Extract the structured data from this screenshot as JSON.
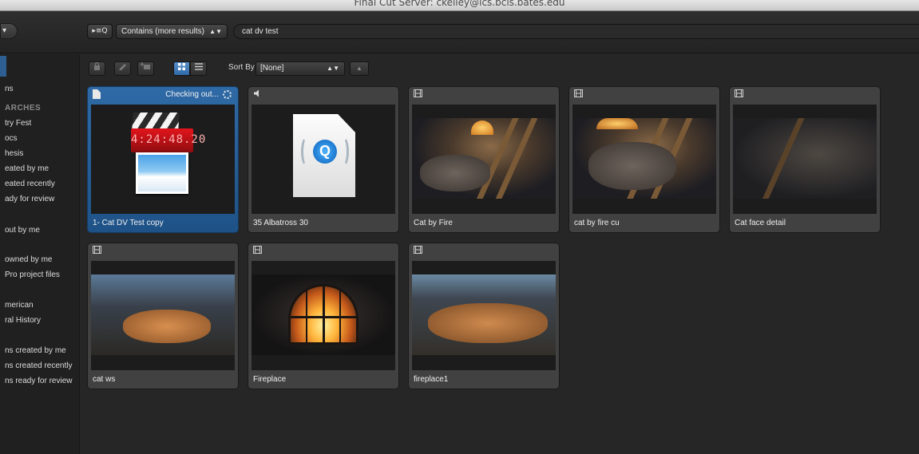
{
  "window": {
    "title": "Final Cut Server: ckelley@ics.bcis.bates.edu"
  },
  "search": {
    "user_menu_label": "▾",
    "mode_button_label": "▸≡Q",
    "mode_select_label": "Contains (more results)",
    "query": "cat dv test"
  },
  "sidebar": {
    "items": [
      {
        "label": "ns",
        "type": "item"
      },
      {
        "label": "ARCHES",
        "type": "heading"
      },
      {
        "label": "try Fest",
        "type": "item"
      },
      {
        "label": "ocs",
        "type": "item"
      },
      {
        "label": "hesis",
        "type": "item"
      },
      {
        "label": "eated by me",
        "type": "item"
      },
      {
        "label": "eated recently",
        "type": "item"
      },
      {
        "label": "ady for review",
        "type": "item"
      },
      {
        "label": "out by me",
        "type": "item"
      },
      {
        "label": "owned by me",
        "type": "item"
      },
      {
        "label": "Pro project files",
        "type": "item"
      },
      {
        "label": "merican",
        "type": "item"
      },
      {
        "label": "ral History",
        "type": "item"
      },
      {
        "label": "ns created by me",
        "type": "item"
      },
      {
        "label": "ns created recently",
        "type": "item"
      },
      {
        "label": "ns ready for review",
        "type": "item"
      }
    ]
  },
  "toolbar": {
    "sort_by_label": "Sort By",
    "sort_by_value": "[None]"
  },
  "assets": [
    {
      "name": "1- Cat DV Test copy",
      "type": "project",
      "status": "Checking out...",
      "selected": true
    },
    {
      "name": "35 Albatross 30",
      "type": "audio",
      "status": "",
      "selected": false
    },
    {
      "name": "Cat by Fire",
      "type": "video",
      "status": "",
      "selected": false
    },
    {
      "name": "cat by fire cu",
      "type": "video",
      "status": "",
      "selected": false
    },
    {
      "name": "Cat face detail",
      "type": "video",
      "status": "",
      "selected": false
    },
    {
      "name": "cat ws",
      "type": "video",
      "status": "",
      "selected": false
    },
    {
      "name": "Fireplace",
      "type": "video",
      "status": "",
      "selected": false
    },
    {
      "name": "fireplace1",
      "type": "video",
      "status": "",
      "selected": false
    }
  ],
  "thumbnail_texts": {
    "timecode": "4:24:48.20"
  },
  "colors": {
    "selection": "#2f6aa6",
    "tile": "#414141",
    "background": "#262626"
  }
}
